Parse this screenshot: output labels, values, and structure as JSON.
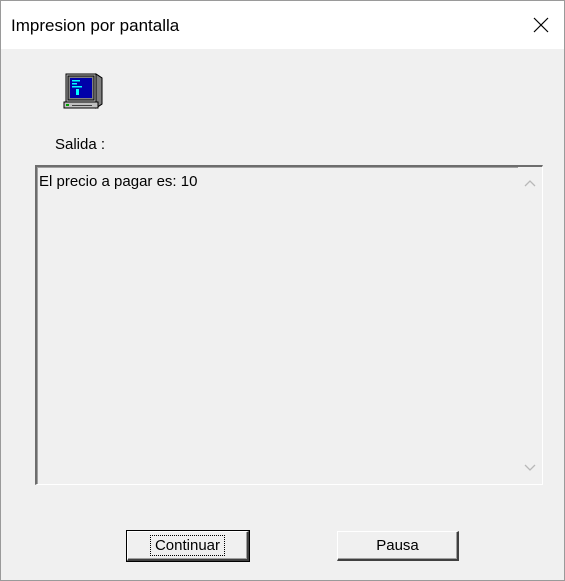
{
  "window": {
    "title": "Impresion por pantalla",
    "close_icon": "close-icon"
  },
  "content": {
    "icon": "computer-icon",
    "salida_label": "Salida :",
    "output_text": "El precio a pagar es: 10"
  },
  "buttons": {
    "continuar_label": "Continuar",
    "pausa_label": "Pausa"
  }
}
